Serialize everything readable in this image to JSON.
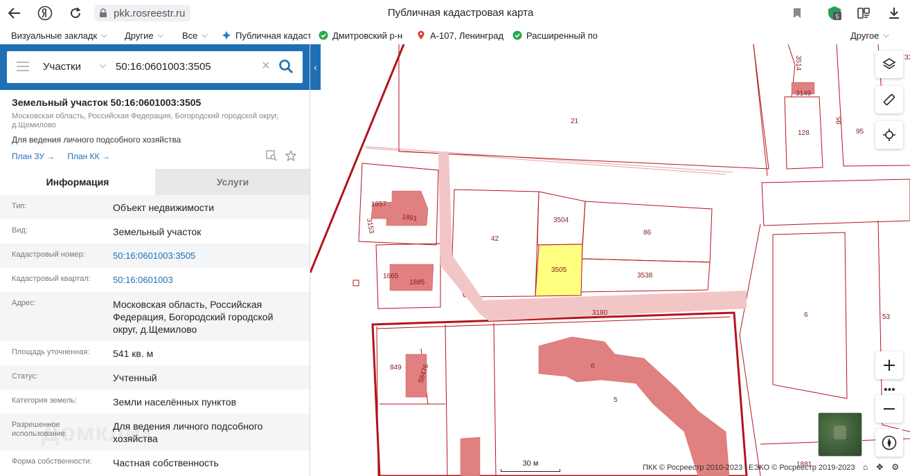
{
  "browser": {
    "url": "pkk.rosreestr.ru",
    "title": "Публичная кадастровая карта",
    "ext_badge": "5",
    "bookmarks": [
      {
        "label": "Визуальные закладк",
        "chev": "⌵"
      },
      {
        "label": "Другие",
        "chev": "⌵"
      },
      {
        "label": "Все",
        "chev": "⌵"
      },
      {
        "label": "Публичная кадаст"
      },
      {
        "label": "Дмитровский р-н"
      },
      {
        "label": "А-107, Ленинград"
      },
      {
        "label": "Расширенный по"
      }
    ],
    "bookmarks_other": "Другое"
  },
  "search": {
    "type": "Участки",
    "value": "50:16:0601003:3505"
  },
  "object": {
    "title": "Земельный участок 50:16:0601003:3505",
    "address": "Московская область, Российская Федерация, Богородский городской округ, д.Щемилово",
    "use": "Для ведения личного подсобного хозяйства",
    "link_plan_zu": "План ЗУ →",
    "link_plan_kk": "План КК →"
  },
  "tabs": {
    "info": "Информация",
    "services": "Услуги"
  },
  "rows": [
    {
      "label": "Тип:",
      "value": "Объект недвижимости"
    },
    {
      "label": "Вид:",
      "value": "Земельный участок"
    },
    {
      "label": "Кадастровый номер:",
      "value": "50:16:0601003:3505"
    },
    {
      "label": "Кадастровый квартал:",
      "value": "50:16:0601003"
    },
    {
      "label": "Адрес:",
      "value": "Московская область, Российская Федерация, Богородский городской округ, д.Щемилово"
    },
    {
      "label": "Площадь уточненная:",
      "value": "541 кв. м"
    },
    {
      "label": "Статус:",
      "value": "Учтенный"
    },
    {
      "label": "Категория земель:",
      "value": "Земли населённых пунктов"
    },
    {
      "label": "Разрешенное использование:",
      "value": "Для ведения личного подсобного хозяйства"
    },
    {
      "label": "Форма собственности:",
      "value": "Частная собственность"
    }
  ],
  "watermark": "Домклик",
  "map": {
    "parcel_labels": [
      "21",
      "3514",
      "3149",
      "128",
      "95",
      "95",
      "33",
      "1857",
      "1891",
      "3153",
      "3504",
      "86",
      "42",
      "3505",
      "3538",
      "1665",
      "1885",
      "3180",
      "6",
      "53",
      "849",
      "58476",
      "6",
      "5",
      "1881"
    ],
    "scale_label": "30 м",
    "copyright": "ПКК © Росреестр 2010-2023 | ЕЭКО © Росреестр 2019-2023",
    "colors": {
      "parcel_border": "#b5121b",
      "building": "#e08080",
      "selected": "#ffff80",
      "road": "#f2c6c6"
    }
  }
}
